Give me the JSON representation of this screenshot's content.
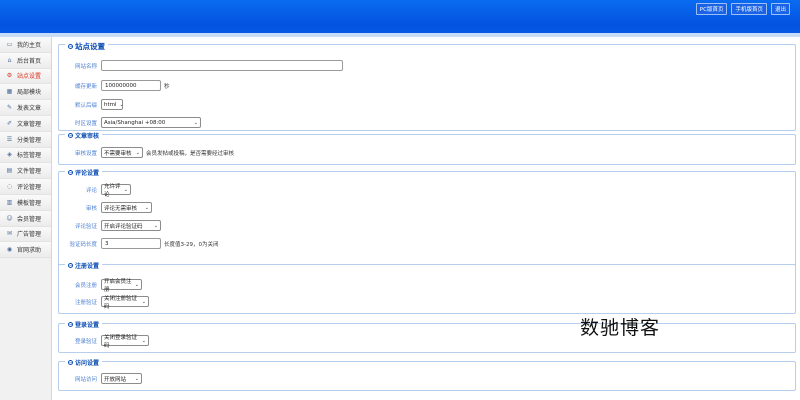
{
  "header": {
    "links": [
      "PC版首页",
      "手机版首页",
      "退出"
    ]
  },
  "sidebar": {
    "items": [
      {
        "label": "我的主页",
        "icon": "monitor-icon"
      },
      {
        "label": "后台首页",
        "icon": "home-icon"
      },
      {
        "label": "站点设置",
        "icon": "gear-icon",
        "active": true
      },
      {
        "label": "局部模块",
        "icon": "module-icon"
      },
      {
        "label": "发表文章",
        "icon": "edit-icon"
      },
      {
        "label": "文章管理",
        "icon": "doc-edit-icon"
      },
      {
        "label": "分类管理",
        "icon": "category-icon"
      },
      {
        "label": "标签管理",
        "icon": "tag-icon"
      },
      {
        "label": "文件管理",
        "icon": "folder-icon"
      },
      {
        "label": "评论管理",
        "icon": "comment-icon"
      },
      {
        "label": "模板管理",
        "icon": "template-icon"
      },
      {
        "label": "会员管理",
        "icon": "user-icon"
      },
      {
        "label": "广告管理",
        "icon": "ad-icon"
      },
      {
        "label": "官网求助",
        "icon": "help-icon"
      }
    ]
  },
  "site": {
    "title": "站点设置",
    "name_label": "网站名称",
    "name_value": "",
    "cache_label": "缓存更新",
    "cache_value": "100000000",
    "cache_unit": "秒",
    "suffix_label": "默认后缀",
    "suffix_value": "html",
    "tz_label": "时区设置",
    "tz_value": "Asia/Shanghai +08:00"
  },
  "audit": {
    "title": "文章审核",
    "label": "审核设置",
    "value": "不需要审核",
    "hint": "会员发帖或投稿，是否需要经过审核"
  },
  "comment": {
    "title": "评论设置",
    "c1_label": "评论",
    "c1_value": "允许评论",
    "c2_label": "审核",
    "c2_value": "评论无需审核",
    "c3_label": "评论验证",
    "c3_value": "开启评论验证码",
    "c4_label": "验证码长度",
    "c4_value": "3",
    "c4_hint": "长度值3-29，0为关闭"
  },
  "register": {
    "title": "注册设置",
    "r1_label": "会员注册",
    "r1_value": "开启会员注册",
    "r2_label": "注册验证",
    "r2_value": "关闭注册验证码"
  },
  "login": {
    "title": "登录设置",
    "l1_label": "登录验证",
    "l1_value": "关闭登录验证码"
  },
  "visit": {
    "title": "访问设置",
    "v1_label": "网站访问",
    "v1_value": "开放网站"
  },
  "watermark": "数驰博客"
}
